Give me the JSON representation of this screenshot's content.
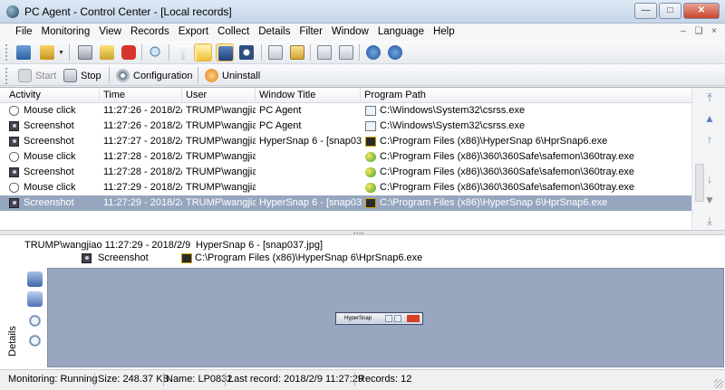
{
  "window": {
    "title": "PC Agent - Control Center - [Local records]"
  },
  "menu": [
    "File",
    "Monitoring",
    "View",
    "Records",
    "Export",
    "Collect",
    "Details",
    "Filter",
    "Window",
    "Language",
    "Help"
  ],
  "actions": {
    "start": "Start",
    "stop": "Stop",
    "configuration": "Configuration",
    "uninstall": "Uninstall"
  },
  "log": {
    "columns": [
      "Activity",
      "Time",
      "User",
      "Window Title",
      "Program Path"
    ],
    "rows": [
      {
        "activity": "Mouse click",
        "icon": "mouse-icon",
        "time": "11:27:26 - 2018/2/9",
        "user": "TRUMP\\wangjiao",
        "window": "PC Agent",
        "program_icon": "window-icon",
        "program": "C:\\Windows\\System32\\csrss.exe"
      },
      {
        "activity": "Screenshot",
        "icon": "camera-icon",
        "time": "11:27:26 - 2018/2/9",
        "user": "TRUMP\\wangjiao",
        "window": "PC Agent",
        "program_icon": "window-icon",
        "program": "C:\\Windows\\System32\\csrss.exe"
      },
      {
        "activity": "Screenshot",
        "icon": "camera-icon",
        "time": "11:27:27 - 2018/2/9",
        "user": "TRUMP\\wangjiao",
        "window": "HyperSnap 6 - [snap037.jpg]",
        "program_icon": "hypersnap-icon",
        "program": "C:\\Program Files (x86)\\HyperSnap 6\\HprSnap6.exe"
      },
      {
        "activity": "Mouse click",
        "icon": "mouse-icon",
        "time": "11:27:28 - 2018/2/9",
        "user": "TRUMP\\wangjiao",
        "window": "",
        "program_icon": "360-icon",
        "program": "C:\\Program Files (x86)\\360\\360Safe\\safemon\\360tray.exe"
      },
      {
        "activity": "Screenshot",
        "icon": "camera-icon",
        "time": "11:27:28 - 2018/2/9",
        "user": "TRUMP\\wangjiao",
        "window": "",
        "program_icon": "360-icon",
        "program": "C:\\Program Files (x86)\\360\\360Safe\\safemon\\360tray.exe"
      },
      {
        "activity": "Mouse click",
        "icon": "mouse-icon",
        "time": "11:27:29 - 2018/2/9",
        "user": "TRUMP\\wangjiao",
        "window": "",
        "program_icon": "360-icon",
        "program": "C:\\Program Files (x86)\\360\\360Safe\\safemon\\360tray.exe"
      },
      {
        "activity": "Screenshot",
        "icon": "camera-icon",
        "time": "11:27:29 - 2018/2/9",
        "user": "TRUMP\\wangjiao",
        "window": "HyperSnap 6 - [snap037.jpg]",
        "program_icon": "hypersnap-icon",
        "program": "C:\\Program Files (x86)\\HyperSnap 6\\HprSnap6.exe",
        "selected": true
      }
    ]
  },
  "details": {
    "tab_label": "Details",
    "user_time": "TRUMP\\wangjiao 11:27:29 - 2018/2/9",
    "window_title": "HyperSnap 6 - [snap037.jpg]",
    "activity": "Screenshot",
    "program": "C:\\Program Files (x86)\\HyperSnap 6\\HprSnap6.exe",
    "thumbnail_title": "HyperSnap"
  },
  "status": {
    "monitoring": "Monitoring: Running",
    "size": "Size: 248.37 KB",
    "name": "Name: LP0832",
    "last_record": "Last record: 2018/2/9 11:27:29",
    "records": "Records: 12"
  },
  "colors": {
    "selection": "#96a6bf",
    "preview_bg": "#98a6bf",
    "scroll_arrow": "#5c82bd"
  }
}
